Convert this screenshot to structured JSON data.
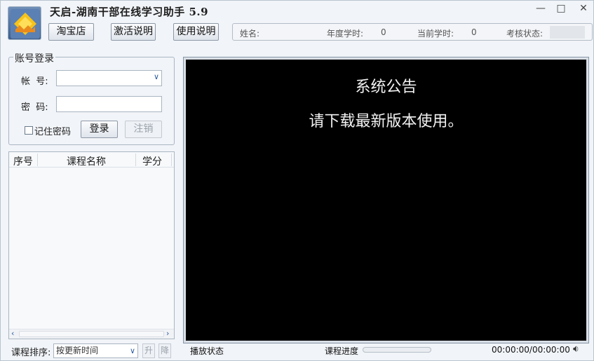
{
  "app": {
    "title": "天启-湖南干部在线学习助手 5.9",
    "window_controls": {
      "minimize": "—",
      "maximize": "□",
      "close": "✕"
    }
  },
  "header": {
    "buttons": {
      "taobao": "淘宝店",
      "activation": "激活说明",
      "usage": "使用说明"
    },
    "status": {
      "name_label": "姓名:",
      "name_value": "",
      "year_hours_label": "年度学时:",
      "year_hours_value": "0",
      "current_hours_label": "当前学时:",
      "current_hours_value": "0",
      "audit_label": "考核状态:",
      "audit_value": ""
    }
  },
  "login": {
    "group_title": "账号登录",
    "account_label": "帐  号:",
    "account_value": "",
    "password_label": "密  码:",
    "password_value": "",
    "remember_label": "记住密码",
    "remember_checked": false,
    "login_button": "登录",
    "logout_button": "注销"
  },
  "course_list": {
    "columns": [
      "序号",
      "课程名称",
      "学分"
    ],
    "rows": []
  },
  "sort": {
    "label": "课程排序:",
    "selected": "按更新时间",
    "up_button": "升",
    "down_button": "降"
  },
  "player": {
    "notice_title": "系统公告",
    "notice_body": "请下载最新版本使用。",
    "status_label": "播放状态",
    "progress_label": "课程进度",
    "progress_value": 0,
    "time": "00:00:00/00:00:00",
    "icons": {
      "volume": "speaker-icon"
    }
  },
  "colors": {
    "screen_bg": "#000000",
    "window_bg": "#f1f4f8",
    "accent": "#2c5aa0"
  }
}
